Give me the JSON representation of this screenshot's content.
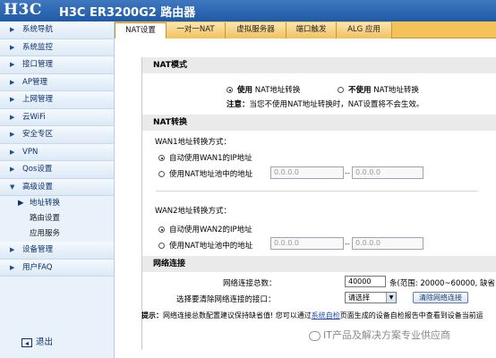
{
  "header": {
    "logo": "H3C",
    "product": "H3C ER3200G2 路由器"
  },
  "sidebar": {
    "items": [
      {
        "label": "系统导航",
        "arrow": "▶"
      },
      {
        "label": "系统监控",
        "arrow": "▶"
      },
      {
        "label": "接口管理",
        "arrow": "▶"
      },
      {
        "label": "AP管理",
        "arrow": "▶"
      },
      {
        "label": "上网管理",
        "arrow": "▶"
      },
      {
        "label": "云WiFi",
        "arrow": "▶"
      },
      {
        "label": "安全专区",
        "arrow": "▶"
      },
      {
        "label": "VPN",
        "arrow": "▶"
      },
      {
        "label": "Qos设置",
        "arrow": "▶"
      },
      {
        "label": "高级设置",
        "arrow": "▼"
      }
    ],
    "sub_items": [
      {
        "label": "地址转换",
        "active": true,
        "dot": "▶"
      },
      {
        "label": "路由设置"
      },
      {
        "label": "应用服务"
      }
    ],
    "bottom_items": [
      {
        "label": "设备管理",
        "arrow": "▶"
      },
      {
        "label": "用户FAQ",
        "arrow": "▶"
      }
    ],
    "exit_label": "退出"
  },
  "tabs": [
    {
      "label": "NAT设置",
      "active": true
    },
    {
      "label": "一对一NAT"
    },
    {
      "label": "虚拟服务器"
    },
    {
      "label": "端口触发"
    },
    {
      "label": "ALG 应用"
    }
  ],
  "nat_mode": {
    "title": "NAT模式",
    "use_label": "使用 NAT地址转换",
    "no_use_label": "不使用 NAT地址转换",
    "use_prefix": "使用",
    "no_use_prefix": "不使用",
    "note_label": "注意：",
    "note_text": "当您不使用NAT地址转换时，NAT设置将不会生效。"
  },
  "nat_translation": {
    "title": "NAT转换",
    "wan1": {
      "label": "WAN1地址转换方式：",
      "auto_label": "自动使用WAN1的IP地址",
      "pool_label": "使用NAT地址池中的地址",
      "pool_start": "0.0.0.0",
      "pool_end": "0.0.0.0",
      "dash": "--"
    },
    "wan2": {
      "label": "WAN2地址转换方式：",
      "auto_label": "自动使用WAN2的IP地址",
      "pool_label": "使用NAT地址池中的地址",
      "pool_start": "0.0.0.0",
      "pool_end": "0.0.0.0",
      "dash": "--"
    }
  },
  "network_connection": {
    "title": "网络连接",
    "total_label": "网络连接总数：",
    "total_value": "40000",
    "total_hint": "条(范围: 20000~60000, 缺省",
    "clear_label": "选择要清除网络连接的接口：",
    "clear_select": "请选择",
    "clear_button": "清除网络连接"
  },
  "tip": {
    "label": "提示：",
    "text_before": "网络连接总数配置建议保持缺省值! 您可以通过",
    "link": "系统自检",
    "text_after": "页面生成的设备自检报告中查看到设备当前运"
  },
  "watermark": "IT产品及解决方案专业供应商"
}
